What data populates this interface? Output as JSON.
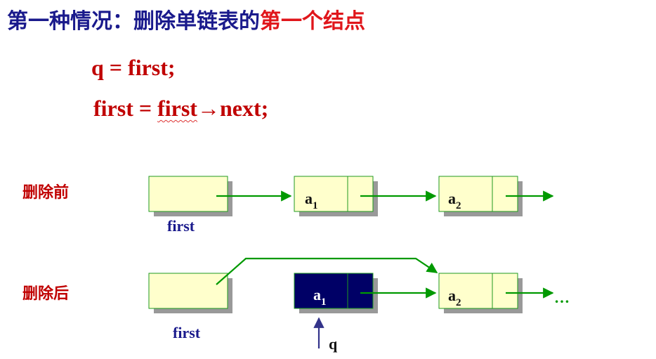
{
  "title": {
    "part1": "第一种情况：删除单链表的",
    "part2": "第一个结点"
  },
  "code": {
    "line1": "q = first;",
    "line2_a": "first = ",
    "line2_b": "first",
    "line2_c": "→next;"
  },
  "before": {
    "label": "删除前",
    "first_label": "first",
    "node1": "a",
    "node1_sub": "1",
    "node2": "a",
    "node2_sub": "2"
  },
  "after": {
    "label": "删除后",
    "first_label": "first",
    "node1": "a",
    "node1_sub": "1",
    "node2": "a",
    "node2_sub": "2",
    "ellipsis": "…",
    "q_label": "q"
  },
  "colors": {
    "title_blue": "#1a1a8c",
    "title_red": "#e0161b",
    "code_red": "#c00000",
    "node_fill": "#ffffcc",
    "node_border": "#1f9a1f",
    "arrow_green": "#009900",
    "deleted_fill": "#000066",
    "pointer_blue": "#33338a"
  }
}
